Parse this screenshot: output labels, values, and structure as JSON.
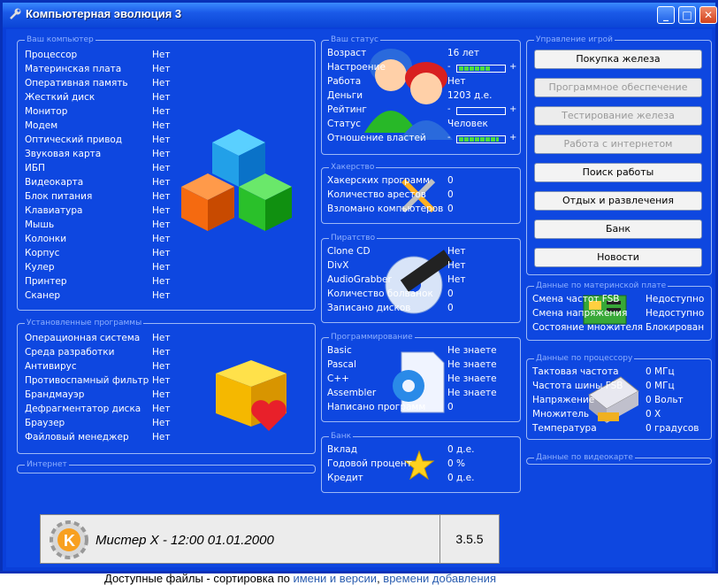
{
  "window": {
    "title": "Компьютерная эволюция 3"
  },
  "hardware": {
    "title": "Ваш компьютер",
    "items": [
      {
        "k": "Процессор",
        "v": "Нет"
      },
      {
        "k": "Материнская плата",
        "v": "Нет"
      },
      {
        "k": "Оперативная память",
        "v": "Нет"
      },
      {
        "k": "Жесткий диск",
        "v": "Нет"
      },
      {
        "k": "Монитор",
        "v": "Нет"
      },
      {
        "k": "Модем",
        "v": "Нет"
      },
      {
        "k": "Оптический привод",
        "v": "Нет"
      },
      {
        "k": "Звуковая карта",
        "v": "Нет"
      },
      {
        "k": "ИБП",
        "v": "Нет"
      },
      {
        "k": "Видеокарта",
        "v": "Нет"
      },
      {
        "k": "Блок питания",
        "v": "Нет"
      },
      {
        "k": "Клавиатура",
        "v": "Нет"
      },
      {
        "k": "Мышь",
        "v": "Нет"
      },
      {
        "k": "Колонки",
        "v": "Нет"
      },
      {
        "k": "Корпус",
        "v": "Нет"
      },
      {
        "k": "Кулер",
        "v": "Нет"
      },
      {
        "k": "Принтер",
        "v": "Нет"
      },
      {
        "k": "Сканер",
        "v": "Нет"
      }
    ]
  },
  "software": {
    "title": "Установленные программы",
    "items": [
      {
        "k": "Операционная система",
        "v": "Нет"
      },
      {
        "k": "Среда разработки",
        "v": "Нет"
      },
      {
        "k": "Антивирус",
        "v": "Нет"
      },
      {
        "k": "Противоспамный фильтр",
        "v": "Нет"
      },
      {
        "k": "Брандмауэр",
        "v": "Нет"
      },
      {
        "k": "Дефрагментатор диска",
        "v": "Нет"
      },
      {
        "k": "Браузер",
        "v": "Нет"
      },
      {
        "k": "Файловый менеджер",
        "v": "Нет"
      }
    ]
  },
  "internet": {
    "title": "Интернет"
  },
  "status": {
    "title": "Ваш статус",
    "age": {
      "k": "Возраст",
      "v": "16 лет"
    },
    "mood": {
      "k": "Настроение",
      "level": 0.7
    },
    "job": {
      "k": "Работа",
      "v": "Нет"
    },
    "money": {
      "k": "Деньги",
      "v": "1203 д.е."
    },
    "rating": {
      "k": "Рейтинг",
      "level": 0.0
    },
    "statusrow": {
      "k": "Статус",
      "v": "Человек"
    },
    "authorities": {
      "k": "Отношение властей",
      "level": 0.9
    },
    "minus": "-",
    "plus": "+"
  },
  "hacking": {
    "title": "Хакерство",
    "items": [
      {
        "k": "Хакерских программ",
        "v": "0"
      },
      {
        "k": "Количество арестов",
        "v": "0"
      },
      {
        "k": "Взломано компьютеров",
        "v": "0"
      }
    ]
  },
  "piracy": {
    "title": "Пиратство",
    "items": [
      {
        "k": "Clone CD",
        "v": "Нет"
      },
      {
        "k": "DivX",
        "v": "Нет"
      },
      {
        "k": "AudioGrabber",
        "v": "Нет"
      },
      {
        "k": "Количество болванок",
        "v": "0"
      },
      {
        "k": "Записано дисков",
        "v": "0"
      }
    ]
  },
  "programming": {
    "title": "Программирование",
    "items": [
      {
        "k": "Basic",
        "v": "Не знаете"
      },
      {
        "k": "Pascal",
        "v": "Не знаете"
      },
      {
        "k": "C++",
        "v": "Не знаете"
      },
      {
        "k": "Assembler",
        "v": "Не знаете"
      },
      {
        "k": "Написано программ",
        "v": "0"
      }
    ]
  },
  "bank": {
    "title": "Банк",
    "items": [
      {
        "k": "Вклад",
        "v": "0 д.е."
      },
      {
        "k": "Годовой процент",
        "v": "0 %"
      },
      {
        "k": "Кредит",
        "v": "0 д.е."
      }
    ]
  },
  "controls": {
    "title": "Управление игрой",
    "buttons": [
      {
        "label": "Покупка железа",
        "enabled": true
      },
      {
        "label": "Программное обеспечение",
        "enabled": false
      },
      {
        "label": "Тестирование железа",
        "enabled": false
      },
      {
        "label": "Работа с интернетом",
        "enabled": false
      },
      {
        "label": "Поиск работы",
        "enabled": true
      },
      {
        "label": "Отдых и развлечения",
        "enabled": true
      },
      {
        "label": "Банк",
        "enabled": true
      },
      {
        "label": "Новости",
        "enabled": true
      }
    ]
  },
  "motherboard": {
    "title": "Данные по материнской плате",
    "items": [
      {
        "k": "Смена частот FSB",
        "v": "Недоступно"
      },
      {
        "k": "Смена напряжения",
        "v": "Недоступно"
      },
      {
        "k": "Состояние множителя",
        "v": "Блокирован"
      }
    ]
  },
  "overclock": {
    "title": "Данные по процессору",
    "items": [
      {
        "k": "Тактовая частота",
        "v": "0 МГц"
      },
      {
        "k": "Частота шины FSB",
        "v": "0 МГц"
      },
      {
        "k": "Напряжение",
        "v": "0 Вольт"
      },
      {
        "k": "Множитель",
        "v": "0 X"
      },
      {
        "k": "Температура",
        "v": "0 градусов"
      }
    ]
  },
  "cooler": {
    "title": "Данные по видеокарте"
  },
  "statusbar": {
    "player": "Мистер X - 12:00 01.01.2000",
    "version": "3.5.5"
  },
  "page_footer": {
    "prefix": "Доступные файлы - сортировка по ",
    "link1": "имени и версии",
    "sep": ", ",
    "link2": "времени добавления"
  },
  "colors": {
    "accent": "#0e47e0",
    "bar": "#4ddc3e"
  }
}
